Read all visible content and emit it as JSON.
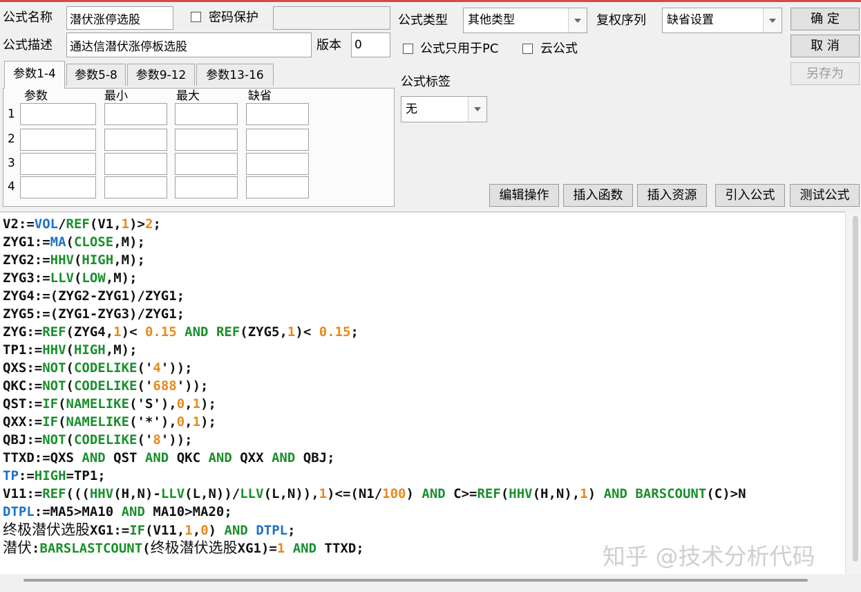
{
  "colors": {
    "keyword": "#1a8f2c",
    "number": "#e8891a",
    "special": "#1a72c8",
    "text": "#111111"
  },
  "formula": {
    "name_label": "公式名称",
    "name_value": "潜伏涨停选股",
    "password_label": "密码保护",
    "password_checked": false,
    "desc_label": "公式描述",
    "desc_value": "通达信潜伏涨停板选股",
    "version_label": "版本",
    "version_value": "0",
    "type_label": "公式类型",
    "type_value": "其他类型",
    "rights_label": "复权序列",
    "rights_value": "缺省设置",
    "pc_only_label": "公式只用于PC",
    "pc_only_checked": false,
    "cloud_label": "云公式",
    "cloud_checked": false,
    "tag_label": "公式标签",
    "tag_value": "无"
  },
  "buttons": {
    "confirm": "确  定",
    "cancel": "取  消",
    "save_as": "另存为",
    "edit_ops": "编辑操作",
    "insert_func": "插入函数",
    "insert_res": "插入资源",
    "import_formula": "引入公式",
    "test_formula": "测试公式"
  },
  "tabs": [
    "参数1-4",
    "参数5-8",
    "参数9-12",
    "参数13-16"
  ],
  "params": {
    "headers": [
      "参数",
      "最小",
      "最大",
      "缺省"
    ],
    "rows": [
      "1",
      "2",
      "3",
      "4"
    ]
  },
  "code_lines": [
    [
      [
        "V2:=",
        "t"
      ],
      [
        "VOL",
        "s"
      ],
      [
        "/",
        "t"
      ],
      [
        "REF",
        "k"
      ],
      [
        "(V1,",
        "t"
      ],
      [
        "1",
        "n"
      ],
      [
        ")>",
        "t"
      ],
      [
        "2",
        "n"
      ],
      [
        ";",
        "t"
      ]
    ],
    [
      [
        "ZYG1:=",
        "t"
      ],
      [
        "MA",
        "s"
      ],
      [
        "(",
        "t"
      ],
      [
        "CLOSE",
        "k"
      ],
      [
        ",M);",
        "t"
      ]
    ],
    [
      [
        "ZYG2:=",
        "t"
      ],
      [
        "HHV",
        "k"
      ],
      [
        "(",
        "t"
      ],
      [
        "HIGH",
        "k"
      ],
      [
        ",M);",
        "t"
      ]
    ],
    [
      [
        "ZYG3:=",
        "t"
      ],
      [
        "LLV",
        "k"
      ],
      [
        "(",
        "t"
      ],
      [
        "LOW",
        "k"
      ],
      [
        ",M);",
        "t"
      ]
    ],
    [
      [
        "ZYG4:=(ZYG2-ZYG1)/ZYG1;",
        "t"
      ]
    ],
    [
      [
        "ZYG5:=(ZYG1-ZYG3)/ZYG1;",
        "t"
      ]
    ],
    [
      [
        "ZYG:=",
        "t"
      ],
      [
        "REF",
        "k"
      ],
      [
        "(ZYG4,",
        "t"
      ],
      [
        "1",
        "n"
      ],
      [
        ")< ",
        "t"
      ],
      [
        "0.15",
        "n"
      ],
      [
        " ",
        "t"
      ],
      [
        "AND",
        "k"
      ],
      [
        " ",
        "t"
      ],
      [
        "REF",
        "k"
      ],
      [
        "(ZYG5,",
        "t"
      ],
      [
        "1",
        "n"
      ],
      [
        ")< ",
        "t"
      ],
      [
        "0.15",
        "n"
      ],
      [
        ";",
        "t"
      ]
    ],
    [
      [
        "TP1:=",
        "t"
      ],
      [
        "HHV",
        "k"
      ],
      [
        "(",
        "t"
      ],
      [
        "HIGH",
        "k"
      ],
      [
        ",M);",
        "t"
      ]
    ],
    [
      [
        "QXS:=",
        "t"
      ],
      [
        "NOT",
        "k"
      ],
      [
        "(",
        "t"
      ],
      [
        "CODELIKE",
        "k"
      ],
      [
        "('",
        "t"
      ],
      [
        "4",
        "n"
      ],
      [
        "'));",
        "t"
      ]
    ],
    [
      [
        "QKC:=",
        "t"
      ],
      [
        "NOT",
        "k"
      ],
      [
        "(",
        "t"
      ],
      [
        "CODELIKE",
        "k"
      ],
      [
        "('",
        "t"
      ],
      [
        "688",
        "n"
      ],
      [
        "'));",
        "t"
      ]
    ],
    [
      [
        "QST:=",
        "t"
      ],
      [
        "IF",
        "k"
      ],
      [
        "(",
        "t"
      ],
      [
        "NAMELIKE",
        "k"
      ],
      [
        "('S'),",
        "t"
      ],
      [
        "0",
        "n"
      ],
      [
        ",",
        "t"
      ],
      [
        "1",
        "n"
      ],
      [
        ");",
        "t"
      ]
    ],
    [
      [
        "QXX:=",
        "t"
      ],
      [
        "IF",
        "k"
      ],
      [
        "(",
        "t"
      ],
      [
        "NAMELIKE",
        "k"
      ],
      [
        "('*'),",
        "t"
      ],
      [
        "0",
        "n"
      ],
      [
        ",",
        "t"
      ],
      [
        "1",
        "n"
      ],
      [
        ");",
        "t"
      ]
    ],
    [
      [
        "QBJ:=",
        "t"
      ],
      [
        "NOT",
        "k"
      ],
      [
        "(",
        "t"
      ],
      [
        "CODELIKE",
        "k"
      ],
      [
        "('",
        "t"
      ],
      [
        "8",
        "n"
      ],
      [
        "'));",
        "t"
      ]
    ],
    [
      [
        "TTXD:=QXS ",
        "t"
      ],
      [
        "AND",
        "k"
      ],
      [
        " QST ",
        "t"
      ],
      [
        "AND",
        "k"
      ],
      [
        " QKC ",
        "t"
      ],
      [
        "AND",
        "k"
      ],
      [
        " QXX ",
        "t"
      ],
      [
        "AND",
        "k"
      ],
      [
        " QBJ;",
        "t"
      ]
    ],
    [
      [
        "TP",
        "s"
      ],
      [
        ":=",
        "t"
      ],
      [
        "HIGH",
        "k"
      ],
      [
        "=TP1;",
        "t"
      ]
    ],
    [
      [
        "V11:=",
        "t"
      ],
      [
        "REF",
        "k"
      ],
      [
        "(((",
        "t"
      ],
      [
        "HHV",
        "k"
      ],
      [
        "(H,N)-",
        "t"
      ],
      [
        "LLV",
        "k"
      ],
      [
        "(L,N))/",
        "t"
      ],
      [
        "LLV",
        "k"
      ],
      [
        "(L,N)),",
        "t"
      ],
      [
        "1",
        "n"
      ],
      [
        ")<=(N1/",
        "t"
      ],
      [
        "100",
        "n"
      ],
      [
        ") ",
        "t"
      ],
      [
        "AND",
        "k"
      ],
      [
        " C>=",
        "t"
      ],
      [
        "REF",
        "k"
      ],
      [
        "(",
        "t"
      ],
      [
        "HHV",
        "k"
      ],
      [
        "(H,N),",
        "t"
      ],
      [
        "1",
        "n"
      ],
      [
        ") ",
        "t"
      ],
      [
        "AND",
        "k"
      ],
      [
        " ",
        "t"
      ],
      [
        "BARSCOUNT",
        "k"
      ],
      [
        "(C)>N",
        "t"
      ]
    ],
    [
      [
        "DTPL",
        "s"
      ],
      [
        ":=MA5>MA10 ",
        "t"
      ],
      [
        "AND",
        "k"
      ],
      [
        " MA10>MA20;",
        "t"
      ]
    ],
    [
      [
        "终极潜伏选股",
        "c"
      ],
      [
        "XG1:=",
        "t"
      ],
      [
        "IF",
        "k"
      ],
      [
        "(V11,",
        "t"
      ],
      [
        "1",
        "n"
      ],
      [
        ",",
        "t"
      ],
      [
        "0",
        "n"
      ],
      [
        ") ",
        "t"
      ],
      [
        "AND",
        "k"
      ],
      [
        " ",
        "t"
      ],
      [
        "DTPL",
        "s"
      ],
      [
        ";",
        "t"
      ]
    ],
    [
      [
        "潜伏",
        "c"
      ],
      [
        ":",
        "t"
      ],
      [
        "BARSLASTCOUNT",
        "k"
      ],
      [
        "(",
        "t"
      ],
      [
        "终极潜伏选股",
        "c"
      ],
      [
        "XG1)=",
        "t"
      ],
      [
        "1",
        "n"
      ],
      [
        " ",
        "t"
      ],
      [
        "AND",
        "k"
      ],
      [
        " TTXD;",
        "t"
      ]
    ]
  ],
  "watermark": "知乎 @技术分析代码"
}
